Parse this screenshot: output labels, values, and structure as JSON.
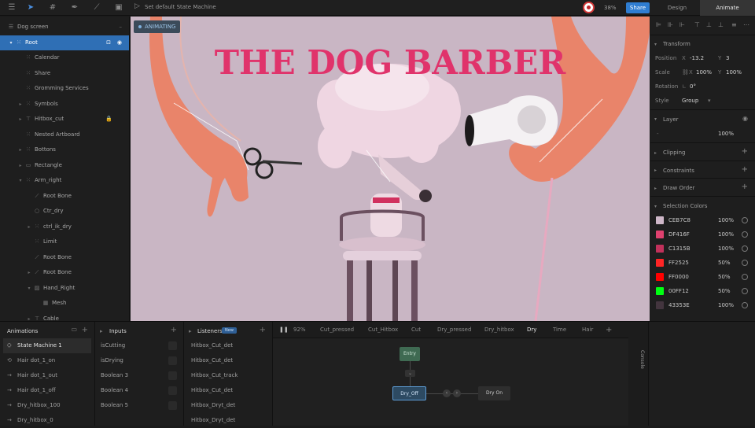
{
  "toolbar": {
    "state_machine_title": "Set default State Machine",
    "zoom": "38%",
    "share_label": "Share",
    "mode_design": "Design",
    "mode_animate": "Animate"
  },
  "hierarchy": {
    "artboard": "Dog screen",
    "items": [
      {
        "label": "Root"
      },
      {
        "label": "Calendar"
      },
      {
        "label": "Share"
      },
      {
        "label": "Gromming Services"
      },
      {
        "label": "Symbols"
      },
      {
        "label": "Hitbox_cut"
      },
      {
        "label": "Nested Artboard"
      },
      {
        "label": "Bottons"
      },
      {
        "label": "Rectangle"
      },
      {
        "label": "Arm_right"
      },
      {
        "label": "Root Bone"
      },
      {
        "label": "Ctr_dry"
      },
      {
        "label": "ctrl_ik_dry"
      },
      {
        "label": "Limit"
      },
      {
        "label": "Root Bone"
      },
      {
        "label": "Root Bone"
      },
      {
        "label": "Hand_Right"
      },
      {
        "label": "Mesh"
      },
      {
        "label": "Cable"
      }
    ]
  },
  "stage": {
    "badge": "ANIMATING",
    "headline": "THE DOG BARBER"
  },
  "inspector": {
    "transform": {
      "title": "Transform",
      "position_label": "Position",
      "x_label": "X",
      "x_value": "-13.2",
      "y_label": "Y",
      "y_value": "3",
      "scale_label": "Scale",
      "scale_x": "100%",
      "scale_y": "100%",
      "rotation_label": "Rotation",
      "rotation_value": "0°",
      "style_label": "Style",
      "style_value": "Group"
    },
    "layer": {
      "title": "Layer",
      "mode": "-",
      "opacity": "100%"
    },
    "clipping": "Clipping",
    "constraints": "Constraints",
    "draw_order": "Draw Order",
    "selection_colors_title": "Selection Colors",
    "colors": [
      {
        "hex": "CEB7C8",
        "pct": "100%",
        "color": "#CEB7C8"
      },
      {
        "hex": "DF416F",
        "pct": "100%",
        "color": "#DF416F"
      },
      {
        "hex": "C1315B",
        "pct": "100%",
        "color": "#C1315B"
      },
      {
        "hex": "FF2525",
        "pct": "50%",
        "color": "#FF2525"
      },
      {
        "hex": "FF0000",
        "pct": "50%",
        "color": "#FF0000"
      },
      {
        "hex": "00FF12",
        "pct": "50%",
        "color": "#00FF12"
      },
      {
        "hex": "43353E",
        "pct": "100%",
        "color": "#43353E"
      }
    ]
  },
  "animations": {
    "title": "Animations",
    "items": [
      {
        "label": "State Machine 1"
      },
      {
        "label": "Hair dot_1_on"
      },
      {
        "label": "Hair dot_1_out"
      },
      {
        "label": "Hair dot_1_off"
      },
      {
        "label": "Dry_hitbox_100"
      },
      {
        "label": "Dry_hitbox_0"
      }
    ]
  },
  "inputs": {
    "title": "Inputs",
    "items": [
      {
        "label": "isCutting"
      },
      {
        "label": "isDrying"
      },
      {
        "label": "Boolean 3"
      },
      {
        "label": "Boolean 4"
      },
      {
        "label": "Boolean 5"
      }
    ]
  },
  "listeners": {
    "title": "Listeners",
    "badge": "New",
    "items": [
      {
        "label": "Hitbox_Cut_det"
      },
      {
        "label": "Hitbox_Cut_det"
      },
      {
        "label": "Hitbox_Cut_track"
      },
      {
        "label": "Hitbox_Cut_det"
      },
      {
        "label": "Hitbox_Dryt_det"
      },
      {
        "label": "Hitbox_Dryt_det"
      }
    ]
  },
  "graph": {
    "zoom": "92%",
    "tabs": [
      "Cut_pressed",
      "Cut_Hitbox",
      "Cut",
      "Dry_pressed",
      "Dry_hitbox",
      "Dry",
      "Time",
      "Hair"
    ],
    "active_tab": "Dry",
    "nodes": {
      "entry": "Entry",
      "dry_off": "Dry_Off",
      "dry_on": "Dry On"
    }
  },
  "console": {
    "label": "Console"
  },
  "colors": {
    "accent": "#2f6fb5",
    "stage_bg": "#c9b6c4",
    "title_pink": "#e0336b"
  }
}
